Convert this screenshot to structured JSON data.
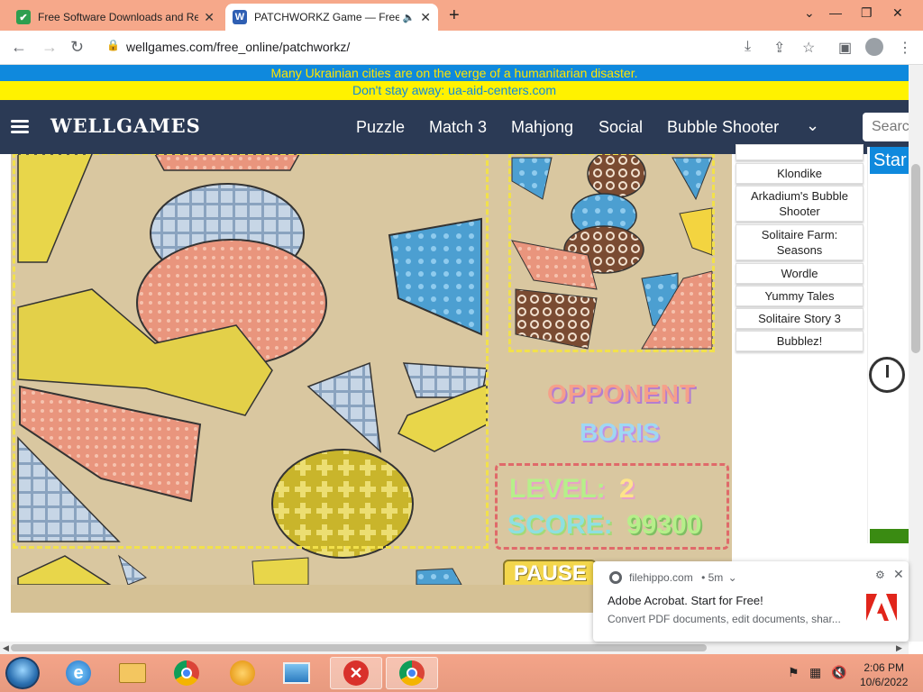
{
  "browser": {
    "tabs": [
      {
        "title": "Free Software Downloads and Re",
        "favicon": "filehippo-favicon-icon"
      },
      {
        "title": "PATCHWORKZ Game — Free",
        "favicon": "wellgames-favicon-icon"
      }
    ],
    "url": "wellgames.com/free_online/patchworkz/"
  },
  "banner": {
    "line1": "Many Ukrainian cities are on the verge of a humanitarian disaster.",
    "line2": "Don't stay away: ua-aid-centers.com"
  },
  "site": {
    "logo": "WELLGAMES",
    "nav": [
      "Puzzle",
      "Match 3",
      "Mahjong",
      "Social",
      "Bubble Shooter"
    ],
    "search_placeholder": "Search"
  },
  "game": {
    "opponent_label": "OPPONENT",
    "opponent_name": "BORIS",
    "level_label": "LEVEL:",
    "level_value": "2",
    "score_label": "SCORE:",
    "score_value": "99300",
    "pause_label": "PAUSE"
  },
  "sidebar": {
    "items": [
      "Klondike",
      "Arkadium's Bubble Shooter",
      "Solitaire Farm: Seasons",
      "Wordle",
      "Yummy Tales",
      "Solitaire Story 3",
      "Bubblez!"
    ],
    "ad_text": "Star"
  },
  "notification": {
    "source": "filehippo.com",
    "age": "• 5m",
    "title": "Adobe Acrobat. Start for Free!",
    "body": "Convert PDF documents, edit documents, shar..."
  },
  "taskbar": {
    "time": "2:06 PM",
    "date": "10/6/2022"
  },
  "colors": {
    "tabstrip": "#f6a88a",
    "banner_blue": "#0f89dd",
    "banner_yellow": "#fff200",
    "nav_bg": "#2b3a55",
    "game_bg": "#d9c7a0"
  }
}
